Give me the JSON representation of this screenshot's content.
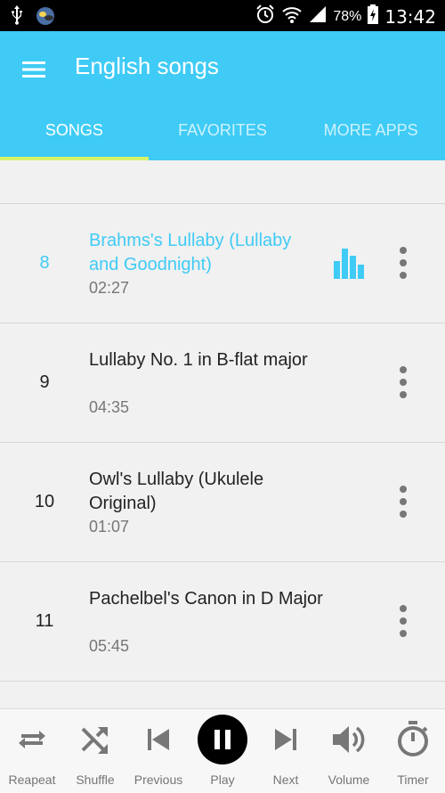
{
  "status_bar": {
    "battery_percent": "78%",
    "time": "13:42",
    "icons": [
      "usb-icon",
      "app-notification-icon",
      "alarm-icon",
      "wifi-icon",
      "signal-icon",
      "battery-charging-icon"
    ]
  },
  "app_bar": {
    "title": "English songs",
    "menu_icon": "hamburger-menu-icon"
  },
  "tabs": [
    {
      "label": "SONGS",
      "active": true
    },
    {
      "label": "FAVORITES",
      "active": false
    },
    {
      "label": "MORE APPS",
      "active": false
    }
  ],
  "songs": [
    {
      "number": "8",
      "title": "Brahms's Lullaby (Lullaby and Goodnight)",
      "duration": "02:27",
      "playing": true
    },
    {
      "number": "9",
      "title": "Lullaby No. 1 in B-flat major",
      "duration": "04:35",
      "playing": false
    },
    {
      "number": "10",
      "title": "Owl's Lullaby (Ukulele Original)",
      "duration": "01:07",
      "playing": false
    },
    {
      "number": "11",
      "title": "Pachelbel's Canon in D Major",
      "duration": "05:45",
      "playing": false
    }
  ],
  "controls": [
    {
      "label": "Reapeat",
      "icon": "repeat-icon"
    },
    {
      "label": "Shuffle",
      "icon": "shuffle-icon"
    },
    {
      "label": "Previous",
      "icon": "skip-previous-icon"
    },
    {
      "label": "Play",
      "icon": "pause-icon"
    },
    {
      "label": "Next",
      "icon": "skip-next-icon"
    },
    {
      "label": "Volume",
      "icon": "volume-icon"
    },
    {
      "label": "Timer",
      "icon": "timer-icon"
    }
  ],
  "colors": {
    "accent": "#3fcbf5",
    "tab_indicator": "#d8f36a",
    "background": "#f1f1f1"
  }
}
